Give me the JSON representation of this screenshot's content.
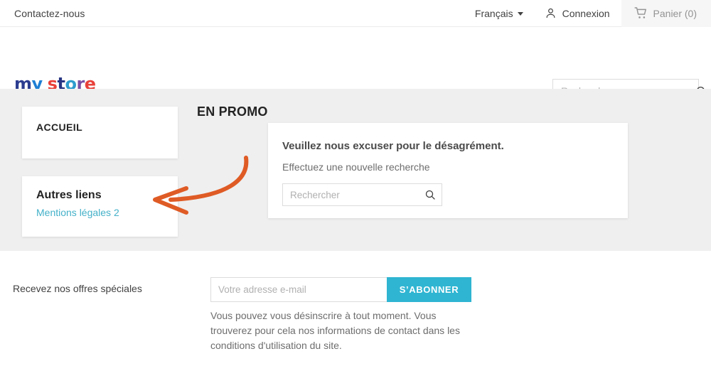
{
  "topnav": {
    "contact_label": "Contactez-nous",
    "language": "Français",
    "signin_label": "Connexion",
    "cart_label": "Panier (0)"
  },
  "header": {
    "logo": {
      "part1": "my",
      "part2": "store",
      "letters": [
        "m",
        "y",
        "s",
        "t",
        "o",
        "r",
        "e"
      ],
      "colors": [
        "#2b3c8f",
        "#1e7fd4",
        "#e8413a",
        "#283583",
        "#2e9ccd",
        "#7a4fa3",
        "#e8413a"
      ]
    },
    "search": {
      "placeholder": "Rechercher",
      "value": ""
    }
  },
  "sidebar": {
    "blocks": [
      {
        "title": "ACCUEIL"
      },
      {
        "title": "Autres liens",
        "link": "Mentions légales 2"
      }
    ]
  },
  "main": {
    "heading": "EN PROMO",
    "card": {
      "title": "Veuillez nous excuser pour le désagrément.",
      "subtitle": "Effectuez une nouvelle recherche",
      "search_placeholder": "Rechercher",
      "search_value": ""
    },
    "annotation": {
      "type": "curved-arrow",
      "color": "#df5b25",
      "points_to": "Autres liens block"
    }
  },
  "footer": {
    "newsletter_label": "Recevez nos offres spéciales",
    "email_placeholder": "Votre adresse e-mail",
    "email_value": "",
    "subscribe_label": "S’ABONNER",
    "note": "Vous pouvez vous désinscrire à tout moment. Vous trouverez pour cela nos informations de contact dans les conditions d'utilisation du site."
  },
  "colors": {
    "accent_teal": "#2fb5d2",
    "link_teal": "#44b1c9",
    "annotation_orange": "#df5b25",
    "page_grey": "#efefef",
    "cart_grey": "#f6f6f6"
  }
}
